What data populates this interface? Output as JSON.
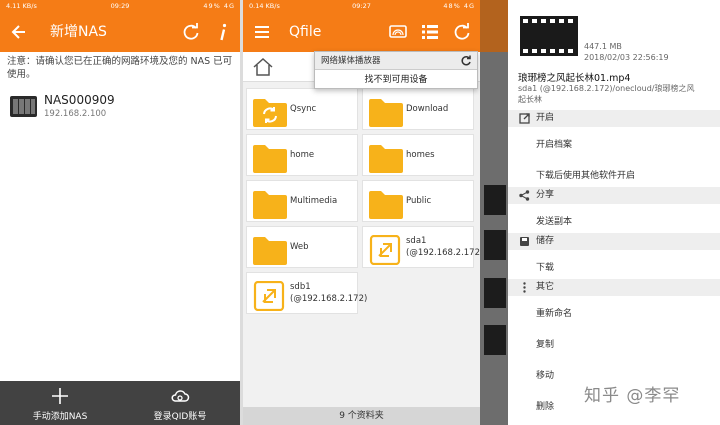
{
  "panel1": {
    "status": {
      "left": "4.11 KB/s",
      "time": "09:29",
      "right": "49% 4G"
    },
    "title": "新增NAS",
    "notice": "注意：请确认您已在正确的网路环境及您的 NAS 已可使用。",
    "nas": {
      "name": "NAS000909",
      "ip": "192.168.2.100"
    },
    "bottom_buttons": [
      {
        "label": "手动添加NAS",
        "icon": "plus-icon"
      },
      {
        "label": "登录QID账号",
        "icon": "cloud-icon"
      }
    ]
  },
  "panel2": {
    "status": {
      "left": "0.14 KB/s",
      "time": "09:27",
      "right": "48% 4G"
    },
    "title": "Qfile",
    "dropdown": {
      "header": "网络媒体播放器",
      "item": "找不到可用设备"
    },
    "folders": [
      {
        "name": "Qsync",
        "icon": "sync-folder-icon"
      },
      {
        "name": "Download",
        "icon": "folder-icon"
      },
      {
        "name": "home",
        "icon": "folder-icon"
      },
      {
        "name": "homes",
        "icon": "folder-icon"
      },
      {
        "name": "Multimedia",
        "icon": "folder-icon"
      },
      {
        "name": "Public",
        "icon": "folder-icon"
      },
      {
        "name": "Web",
        "icon": "folder-icon"
      },
      {
        "name": "sda1 (@192.168.2.172)",
        "icon": "external-drive-icon"
      },
      {
        "name": "sdb1 (@192.168.2.172)",
        "icon": "external-drive-icon"
      }
    ],
    "footer": "9 个资料夹"
  },
  "panel3": {
    "file": {
      "size": "447.1 MB",
      "date": "2018/02/03 22:56:19",
      "name": "琅琊榜之风起长林01.mp4",
      "path": "sda1 (@192.168.2.172)/onecloud/琅琊榜之风起长林"
    },
    "sections": [
      {
        "title": "开启",
        "icon": "open-in-icon",
        "actions": [
          "开启档案",
          "下载后使用其他软件开启"
        ]
      },
      {
        "title": "分享",
        "icon": "share-icon",
        "actions": [
          "发送副本"
        ]
      },
      {
        "title": "储存",
        "icon": "save-icon",
        "actions": [
          "下载"
        ]
      },
      {
        "title": "其它",
        "icon": "more-icon",
        "actions": [
          "重新命名",
          "复制",
          "移动",
          "删除"
        ]
      }
    ],
    "watermark": "知乎 @李罕"
  },
  "colors": {
    "accent": "#f57c16",
    "folder": "#f7b21a",
    "dark_bar": "#424242"
  }
}
